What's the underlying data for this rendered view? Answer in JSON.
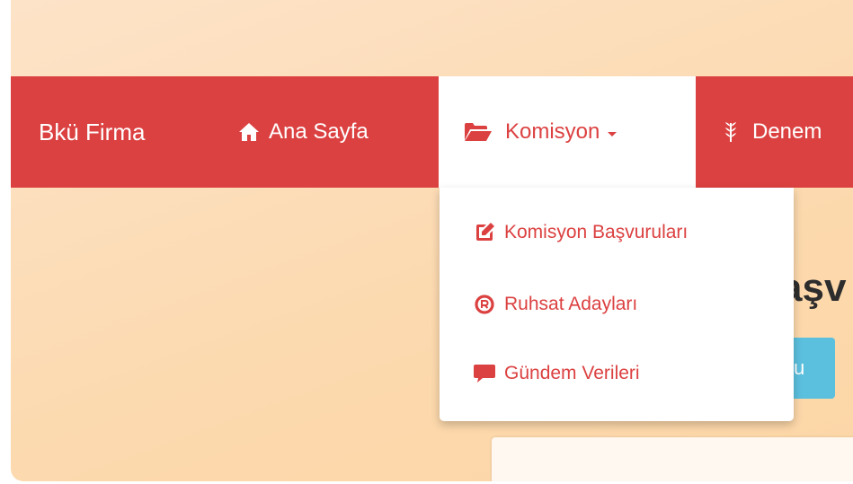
{
  "navbar": {
    "brand": "Bkü Firma",
    "items": [
      {
        "label": "Ana Sayfa",
        "icon": "home-icon"
      },
      {
        "label": "Komisyon",
        "icon": "folder-open-icon",
        "active": true
      },
      {
        "label": "Denem",
        "icon": "wheat-icon"
      }
    ]
  },
  "dropdown": {
    "items": [
      {
        "label": "Komisyon Başvuruları",
        "icon": "edit-icon"
      },
      {
        "label": "Ruhsat Adayları",
        "icon": "registered-icon"
      },
      {
        "label": "Gündem Verileri",
        "icon": "comment-icon"
      }
    ]
  },
  "background": {
    "heading_fragment": "aşv",
    "button_fragment": "u"
  },
  "colors": {
    "accent": "#dc4141",
    "background": "#fcd9ae",
    "info_button": "#5bc0de"
  }
}
